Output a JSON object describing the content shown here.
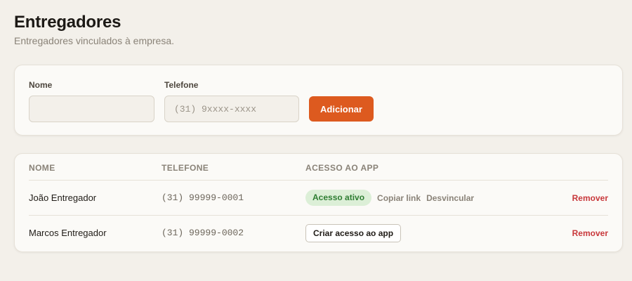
{
  "header": {
    "title": "Entregadores",
    "subtitle": "Entregadores vinculados à empresa."
  },
  "form": {
    "name_label": "Nome",
    "name_value": "",
    "phone_label": "Telefone",
    "phone_placeholder": "(31) 9xxxx-xxxx",
    "add_button": "Adicionar"
  },
  "table": {
    "columns": [
      "NOME",
      "TELEFONE",
      "ACESSO AO APP"
    ],
    "rows": [
      {
        "name": "João Entregador",
        "phone": "(31) 99999-0001",
        "access_status": "Acesso ativo",
        "copy_link": "Copiar link",
        "unlink": "Desvincular",
        "remove": "Remover"
      },
      {
        "name": "Marcos Entregador",
        "phone": "(31) 99999-0002",
        "create_access": "Criar acesso ao app",
        "remove": "Remover"
      }
    ]
  },
  "colors": {
    "background": "#f3f0ea",
    "card": "#fbfaf7",
    "accent": "#dd5a1f",
    "success_bg": "#dcefd7",
    "success_text": "#2e7d32",
    "danger": "#c8383b"
  }
}
